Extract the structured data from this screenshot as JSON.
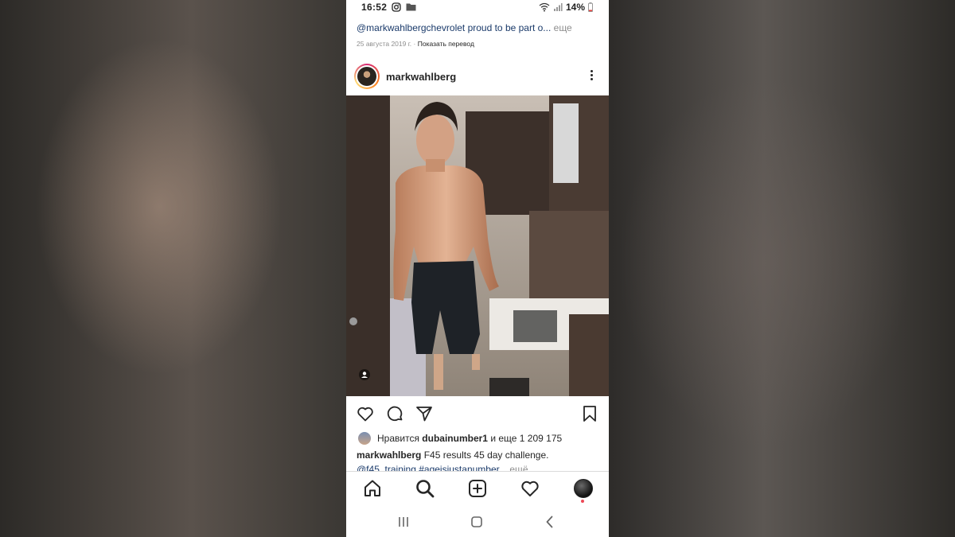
{
  "status": {
    "time": "16:52",
    "battery": "14%"
  },
  "previous_post": {
    "caption": "@markwahlbergchevrolet proud to be part o... ",
    "caption_more": "еще",
    "date": "25 августа 2019 г.",
    "translate": "Показать перевод"
  },
  "post": {
    "username": "markwahlberg",
    "likes_prefix": "Нравится ",
    "likes_user": "dubainumber1",
    "likes_suffix": " и еще 1 209 175",
    "caption_user": "markwahlberg",
    "caption_text": " F45 results 45 day challenge.",
    "caption_tags": "@f45_training #ageisjustanumber... ",
    "caption_more": "ещё"
  },
  "icons": {
    "like": "heart-icon",
    "comment": "comment-icon",
    "share": "send-icon",
    "save": "bookmark-icon",
    "home": "home-icon",
    "search": "search-icon",
    "new_post": "add-post-icon",
    "activity": "heart-icon",
    "more": "more-vertical-icon"
  },
  "colors": {
    "link": "#1a3a6a",
    "text": "#262626",
    "muted": "#8e8e8e",
    "notification": "#ed4956"
  }
}
